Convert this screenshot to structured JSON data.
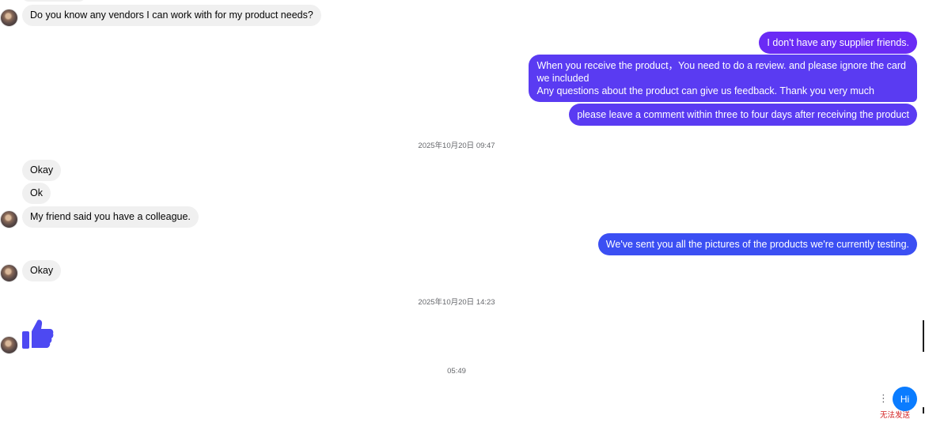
{
  "messages_in": [
    {
      "id": "q-vendors",
      "text": "Do you know any vendors I can work with for my product needs?"
    },
    {
      "id": "okay-1",
      "text": "Okay"
    },
    {
      "id": "ok",
      "text": "Ok"
    },
    {
      "id": "friend",
      "text": "My friend said you have a colleague."
    },
    {
      "id": "okay-2",
      "text": "Okay"
    }
  ],
  "messages_out": [
    {
      "id": "no-supplier",
      "text": "I don't have any supplier friends."
    },
    {
      "id": "review-1",
      "text": "When you receive the product，You need to do a review. and please ignore the card"
    },
    {
      "id": "review-2",
      "text": "we included"
    },
    {
      "id": "review-3",
      "text": "Any questions about the product can give us feedback. Thank you very much"
    },
    {
      "id": "comment",
      "text": "please leave a comment within three to four days after receiving the product"
    },
    {
      "id": "pictures",
      "text": "We've sent you all the pictures of the products we're currently testing."
    }
  ],
  "timestamps": [
    "2025年10月20日 09:47",
    "2025年10月20日 14:23",
    "05:49"
  ],
  "pending": {
    "text": "Hi",
    "error": "无法发送"
  },
  "icons": {
    "reaction": "thumbs-up-icon",
    "more": "more-vertical-icon"
  },
  "colors": {
    "outgoing_purple": "#6a2bf5",
    "outgoing_blue": "#3b4ff3",
    "incoming_bg": "#f0f0f0",
    "send_blue": "#0a7cff",
    "error_red": "#d21f1f"
  }
}
